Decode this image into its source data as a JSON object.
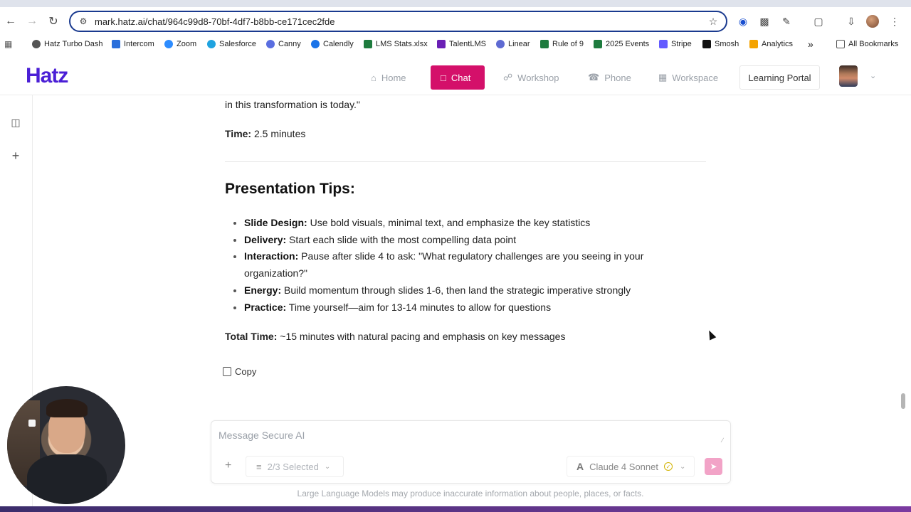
{
  "browser": {
    "url": "mark.hatz.ai/chat/964c99d8-70bf-4df7-b8bb-ce171cec2fde",
    "bookmarks": [
      {
        "label": "Hatz Turbo Dash",
        "color": "#555555"
      },
      {
        "label": "Intercom",
        "color": "#2a6fdb"
      },
      {
        "label": "Zoom",
        "color": "#2d8cff"
      },
      {
        "label": "Salesforce",
        "color": "#1fa3e0"
      },
      {
        "label": "Canny",
        "color": "#5a6ee0"
      },
      {
        "label": "Calendly",
        "color": "#1a73e8"
      },
      {
        "label": "LMS Stats.xlsx",
        "color": "#1e7b3e"
      },
      {
        "label": "TalentLMS",
        "color": "#6a1fb5"
      },
      {
        "label": "Linear",
        "color": "#5e6ad2"
      },
      {
        "label": "Rule of 9",
        "color": "#1e7b3e"
      },
      {
        "label": "2025 Events",
        "color": "#1e7b3e"
      },
      {
        "label": "Stripe",
        "color": "#635bff"
      },
      {
        "label": "Smosh",
        "color": "#111111"
      },
      {
        "label": "Analytics",
        "color": "#f4a300"
      }
    ],
    "all_bookmarks": "All Bookmarks",
    "more": "»"
  },
  "app": {
    "logo": "Hatz",
    "nav": {
      "home": "Home",
      "chat": "Chat",
      "workshop": "Workshop",
      "phone": "Phone",
      "workspace": "Workspace",
      "learning_portal": "Learning Portal"
    },
    "accent": "#d4106a",
    "brand": "#4b1fd6"
  },
  "content": {
    "quote_tail": "in this transformation is today.\"",
    "time_label": "Time:",
    "time_value": " 2.5 minutes",
    "tips_heading": "Presentation Tips:",
    "tips": [
      {
        "label": "Slide Design:",
        "text": " Use bold visuals, minimal text, and emphasize the key statistics"
      },
      {
        "label": "Delivery:",
        "text": " Start each slide with the most compelling data point"
      },
      {
        "label": "Interaction:",
        "text": " Pause after slide 4 to ask: \"What regulatory challenges are you seeing in your organization?\""
      },
      {
        "label": "Energy:",
        "text": " Build momentum through slides 1-6, then land the strategic imperative strongly"
      },
      {
        "label": "Practice:",
        "text": " Time yourself—aim for 13-14 minutes to allow for questions"
      }
    ],
    "total_label": "Total Time:",
    "total_value": " ~15 minutes with natural pacing and emphasis on key messages",
    "copy": "Copy"
  },
  "composer": {
    "placeholder": "Message Secure AI",
    "selected": "2/3 Selected",
    "model": "Claude 4 Sonnet",
    "disclaimer": "Large Language Models may produce inaccurate information about people, places, or facts."
  }
}
